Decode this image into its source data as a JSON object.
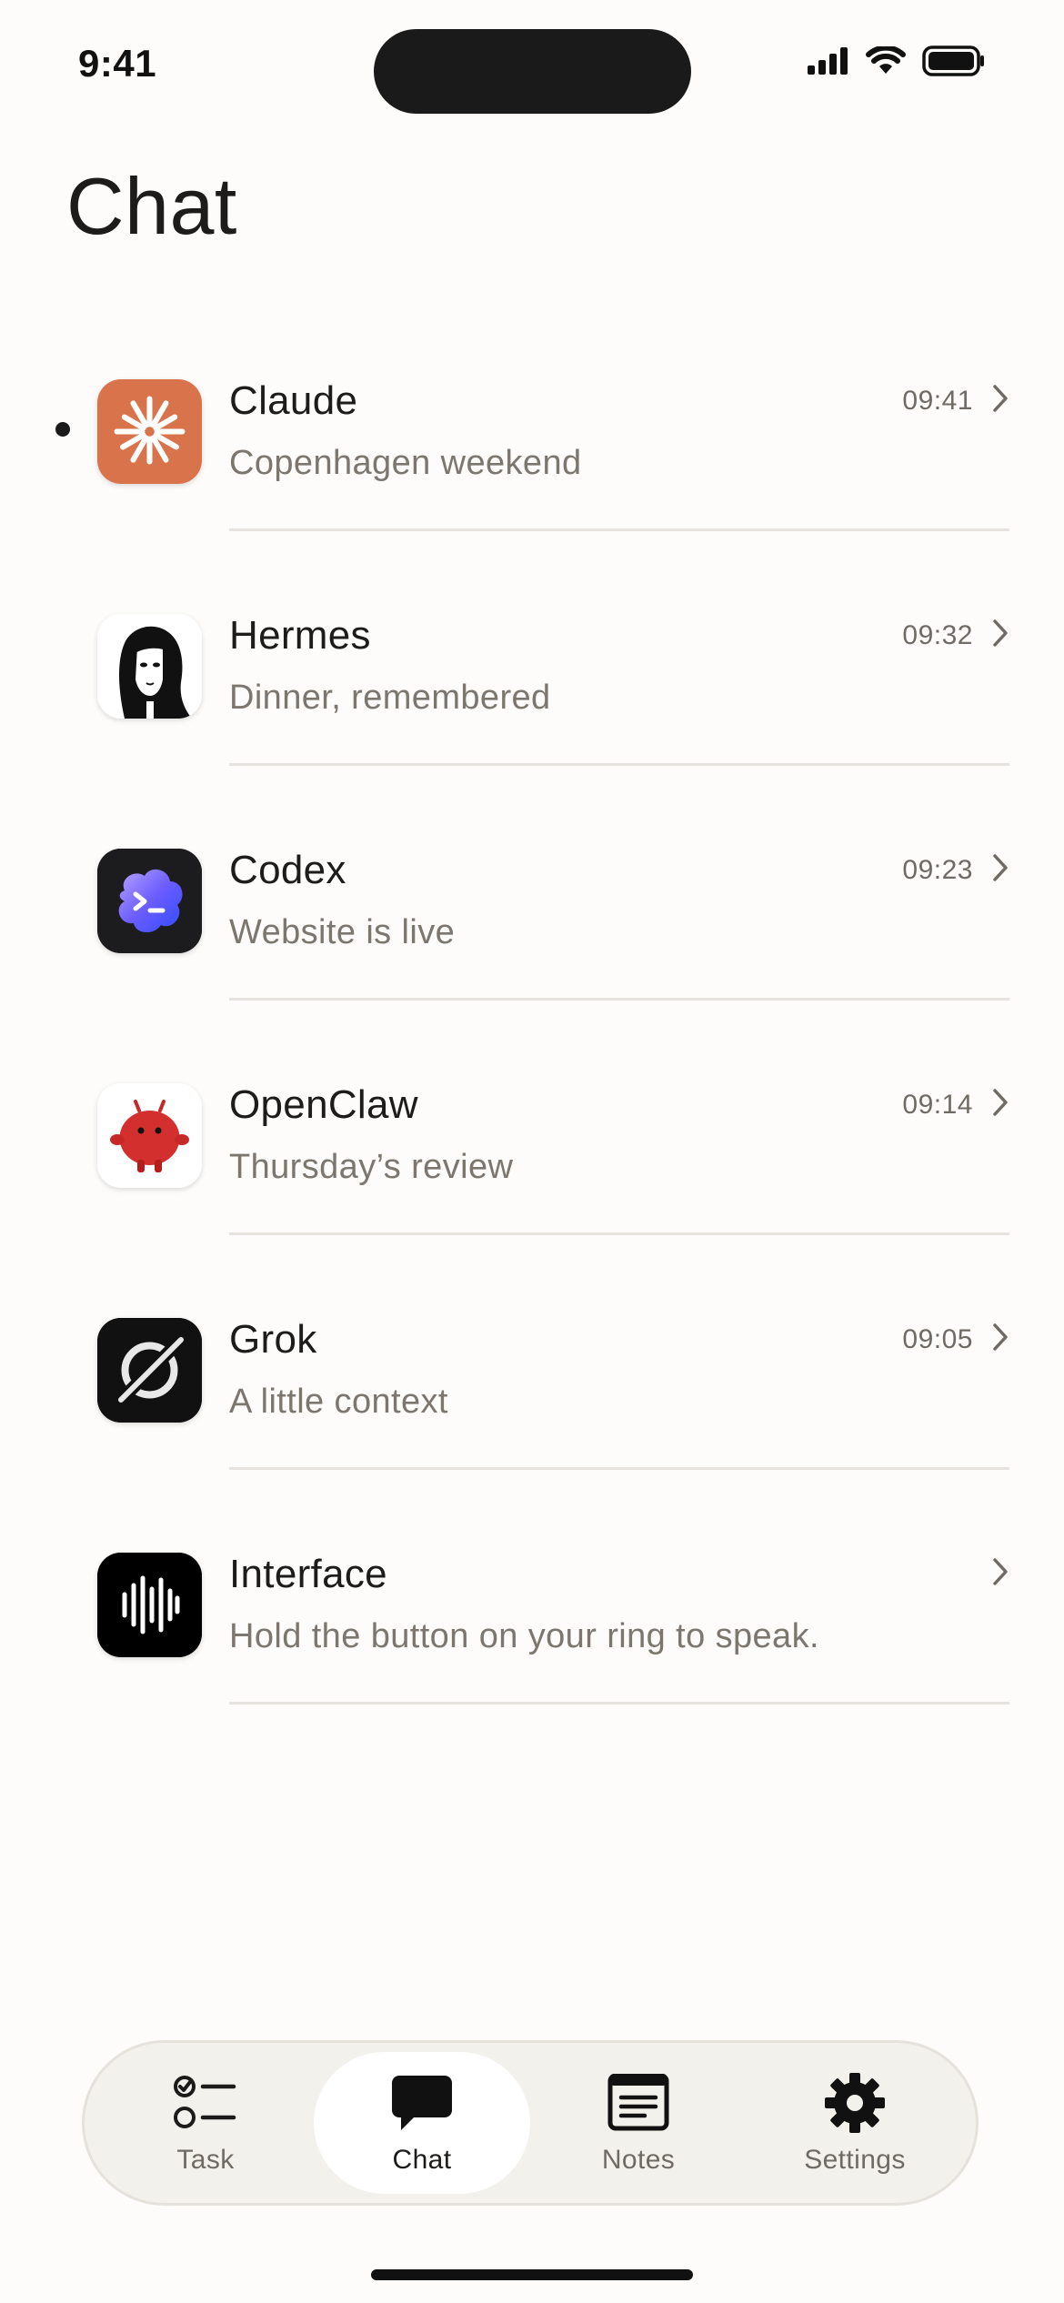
{
  "status_bar": {
    "time": "9:41",
    "icons": [
      "cellular-signal-icon",
      "wifi-icon",
      "battery-icon"
    ]
  },
  "page": {
    "title": "Chat"
  },
  "chats": [
    {
      "name": "Claude",
      "preview": "Copenhagen weekend",
      "time": "09:41",
      "unread": true,
      "avatar_icon": "claude-logo-icon",
      "avatar_color": "#d9734b"
    },
    {
      "name": "Hermes",
      "preview": "Dinner, remembered",
      "time": "09:32",
      "unread": false,
      "avatar_icon": "hermes-portrait-icon",
      "avatar_color": "#ffffff"
    },
    {
      "name": "Codex",
      "preview": "Website is live",
      "time": "09:23",
      "unread": false,
      "avatar_icon": "codex-logo-icon",
      "avatar_color": "#1c1c1e"
    },
    {
      "name": "OpenClaw",
      "preview": "Thursday’s review",
      "time": "09:14",
      "unread": false,
      "avatar_icon": "openclaw-mascot-icon",
      "avatar_color": "#ffffff"
    },
    {
      "name": "Grok",
      "preview": "A little context",
      "time": "09:05",
      "unread": false,
      "avatar_icon": "grok-logo-icon",
      "avatar_color": "#111111"
    },
    {
      "name": "Interface",
      "preview": "Hold the button on your ring to speak.",
      "time": "",
      "unread": false,
      "avatar_icon": "waveform-icon",
      "avatar_color": "#000000"
    }
  ],
  "tab_bar": {
    "tabs": [
      {
        "label": "Task",
        "icon": "task-list-icon",
        "active": false
      },
      {
        "label": "Chat",
        "icon": "chat-bubble-icon",
        "active": true
      },
      {
        "label": "Notes",
        "icon": "notes-icon",
        "active": false
      },
      {
        "label": "Settings",
        "icon": "gear-icon",
        "active": false
      }
    ]
  },
  "colors": {
    "background": "#fdfcfa",
    "text_primary": "#1e1c1a",
    "text_secondary": "#7c766f",
    "divider": "#e6e3de",
    "tab_bar_bg": "#f3f1ec"
  }
}
